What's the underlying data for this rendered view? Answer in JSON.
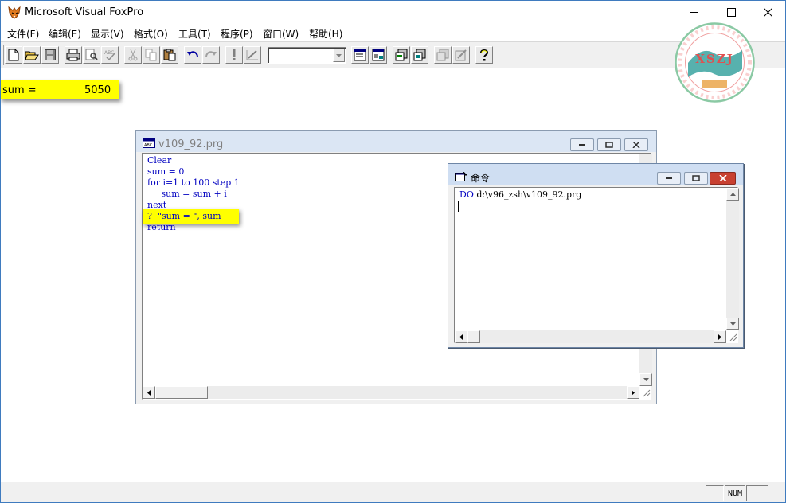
{
  "app": {
    "title": "Microsoft Visual FoxPro"
  },
  "menu": [
    "文件(F)",
    "编辑(E)",
    "显示(V)",
    "格式(O)",
    "工具(T)",
    "程序(P)",
    "窗口(W)",
    "帮助(H)"
  ],
  "toolbar": {
    "icons": [
      "new-file-icon",
      "open-folder-icon",
      "save-icon",
      "print-icon",
      "print-preview-icon",
      "spell-check-icon",
      "cut-icon",
      "copy-icon",
      "paste-icon",
      "undo-icon",
      "redo-icon",
      "run-icon",
      "modify-form-icon",
      "command-window-icon",
      "data-session-icon",
      "form-designer-icon",
      "report-designer-icon",
      "code-icon",
      "builder-icon",
      "help-icon"
    ],
    "combo_value": ""
  },
  "output": {
    "label": "sum =",
    "value": "5050"
  },
  "program_window": {
    "title": "v109_92.prg",
    "lines": [
      "Clear",
      "sum = 0",
      "for i=1 to 100 step 1",
      "     sum = sum + i",
      "next",
      "?  \"sum = \", sum",
      "return"
    ]
  },
  "command_window": {
    "title": "命令",
    "lines": [
      "DO d:\\v96_zsh\\v109_92.prg"
    ]
  },
  "status": {
    "num": "NUM"
  },
  "watermark": {
    "text": "XSZJ"
  },
  "colors": {
    "highlight": "#ffff00",
    "keyword": "#0000c0",
    "accent": "#3f7bbf"
  }
}
